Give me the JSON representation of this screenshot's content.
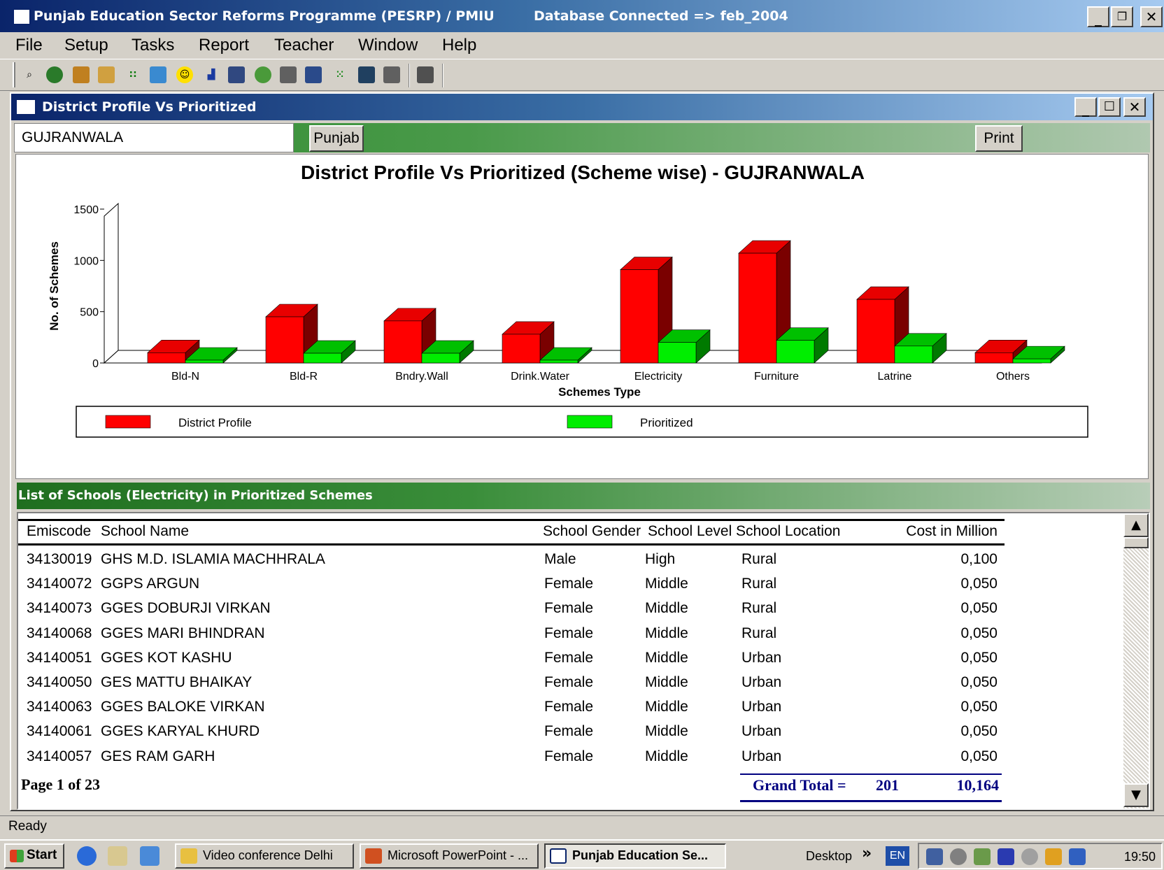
{
  "app": {
    "title": "Punjab Education Sector Reforms Programme (PESRP) / PMIU",
    "db_status": "Database Connected => feb_2004"
  },
  "menu": [
    "File",
    "Setup",
    "Tasks",
    "Report",
    "Teacher",
    "Window",
    "Help"
  ],
  "toolbar": {
    "icons": [
      "find-icon",
      "globe-icon",
      "calculator-icon",
      "users-icon",
      "grid-icon",
      "picture-icon",
      "smiley-icon",
      "bar-chart-icon",
      "network-icon",
      "money-bag-icon",
      "tree-icon",
      "list-icon",
      "dots-icon",
      "table-icon",
      "compare-icon",
      "exit-icon"
    ]
  },
  "child": {
    "title": "District Profile Vs Prioritized",
    "district": "GUJRANWALA",
    "punjab_button": "Punjab",
    "print_button": "Print"
  },
  "chart_data": {
    "type": "bar",
    "title": "District Profile Vs Prioritized (Scheme wise) - GUJRANWALA",
    "xlabel": "Schemes Type",
    "ylabel": "No. of Schemes",
    "categories": [
      "Bld-N",
      "Bld-R",
      "Bndry.Wall",
      "Drink.Water",
      "Electricity",
      "Furniture",
      "Latrine",
      "Others"
    ],
    "series": [
      {
        "name": "District Profile",
        "color": "#ff0000",
        "values": [
          100,
          450,
          410,
          280,
          910,
          1070,
          620,
          100
        ]
      },
      {
        "name": "Prioritized",
        "color": "#00ee00",
        "values": [
          5,
          95,
          95,
          5,
          200,
          220,
          165,
          40
        ]
      }
    ],
    "yticks": [
      0,
      500,
      1000,
      1500
    ],
    "ylim": [
      0,
      1500
    ],
    "grid": false,
    "three_d": true,
    "legend_position": "bottom"
  },
  "list": {
    "title": "List of Schools (Electricity) in Prioritized Schemes",
    "columns": [
      "Emiscode",
      "School Name",
      "School Gender",
      "School Level",
      "School Location",
      "Cost in Million"
    ],
    "rows": [
      [
        "34130019",
        "GHS M.D. ISLAMIA MACHHRALA",
        "Male",
        "High",
        "Rural",
        "0,100"
      ],
      [
        "34140072",
        "GGPS ARGUN",
        "Female",
        "Middle",
        "Rural",
        "0,050"
      ],
      [
        "34140073",
        "GGES DOBURJI VIRKAN",
        "Female",
        "Middle",
        "Rural",
        "0,050"
      ],
      [
        "34140068",
        "GGES MARI BHINDRAN",
        "Female",
        "Middle",
        "Rural",
        "0,050"
      ],
      [
        "34140051",
        "GGES KOT KASHU",
        "Female",
        "Middle",
        "Urban",
        "0,050"
      ],
      [
        "34140050",
        "GES MATTU BHAIKAY",
        "Female",
        "Middle",
        "Urban",
        "0,050"
      ],
      [
        "34140063",
        "GGES BALOKE VIRKAN",
        "Female",
        "Middle",
        "Urban",
        "0,050"
      ],
      [
        "34140061",
        "GGES KARYAL KHURD",
        "Female",
        "Middle",
        "Urban",
        "0,050"
      ],
      [
        "34140057",
        "GES RAM GARH",
        "Female",
        "Middle",
        "Urban",
        "0,050"
      ]
    ],
    "page_info": "Page 1 of 23",
    "grand_total_label": "Grand Total =",
    "grand_total_count": "201",
    "grand_total_cost": "10,164"
  },
  "status": "Ready",
  "taskbar": {
    "start": "Start",
    "tasks": [
      "Video conference Delhi",
      "Microsoft PowerPoint - ...",
      "Punjab Education Se..."
    ],
    "desktop": "Desktop",
    "language": "EN",
    "clock": "19:50"
  }
}
